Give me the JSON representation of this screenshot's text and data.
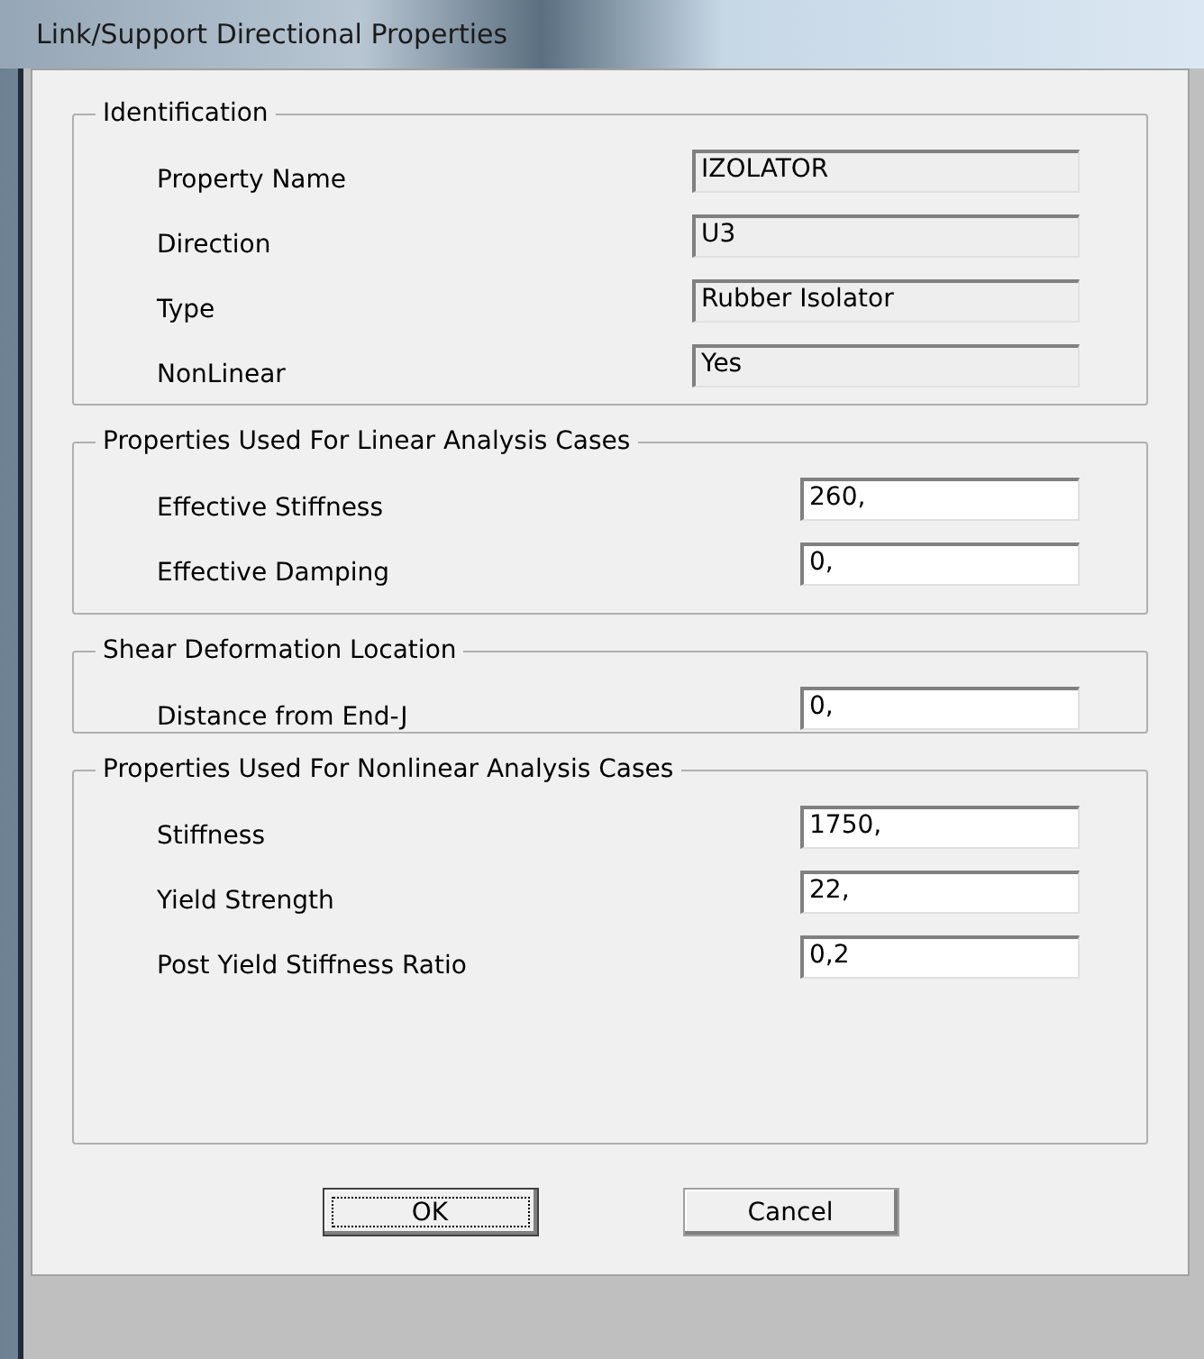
{
  "window": {
    "title": "Link/Support Directional Properties"
  },
  "groups": [
    {
      "title": "Identification",
      "rows": [
        {
          "label": "Property Name",
          "value": "IZOLATOR",
          "kind": "readonly"
        },
        {
          "label": "Direction",
          "value": "U3",
          "kind": "readonly"
        },
        {
          "label": "Type",
          "value": "Rubber Isolator",
          "kind": "readonly"
        },
        {
          "label": "NonLinear",
          "value": "Yes",
          "kind": "readonly"
        }
      ]
    },
    {
      "title": "Properties Used For Linear Analysis Cases",
      "rows": [
        {
          "label": "Effective Stiffness",
          "value": "260,",
          "kind": "edit"
        },
        {
          "label": "Effective Damping",
          "value": "0,",
          "kind": "edit"
        }
      ]
    },
    {
      "title": "Shear Deformation Location",
      "rows": [
        {
          "label": "Distance from End-J",
          "value": "0,",
          "kind": "edit"
        }
      ]
    },
    {
      "title": "Properties Used For Nonlinear Analysis Cases",
      "rows": [
        {
          "label": "Stiffness",
          "value": "1750,",
          "kind": "edit"
        },
        {
          "label": "Yield Strength",
          "value": "22,",
          "kind": "edit"
        },
        {
          "label": "Post Yield Stiffness Ratio",
          "value": "0,2",
          "kind": "edit"
        }
      ]
    }
  ],
  "buttons": [
    {
      "label": "OK",
      "focused": true
    },
    {
      "label": "Cancel",
      "focused": false
    }
  ]
}
